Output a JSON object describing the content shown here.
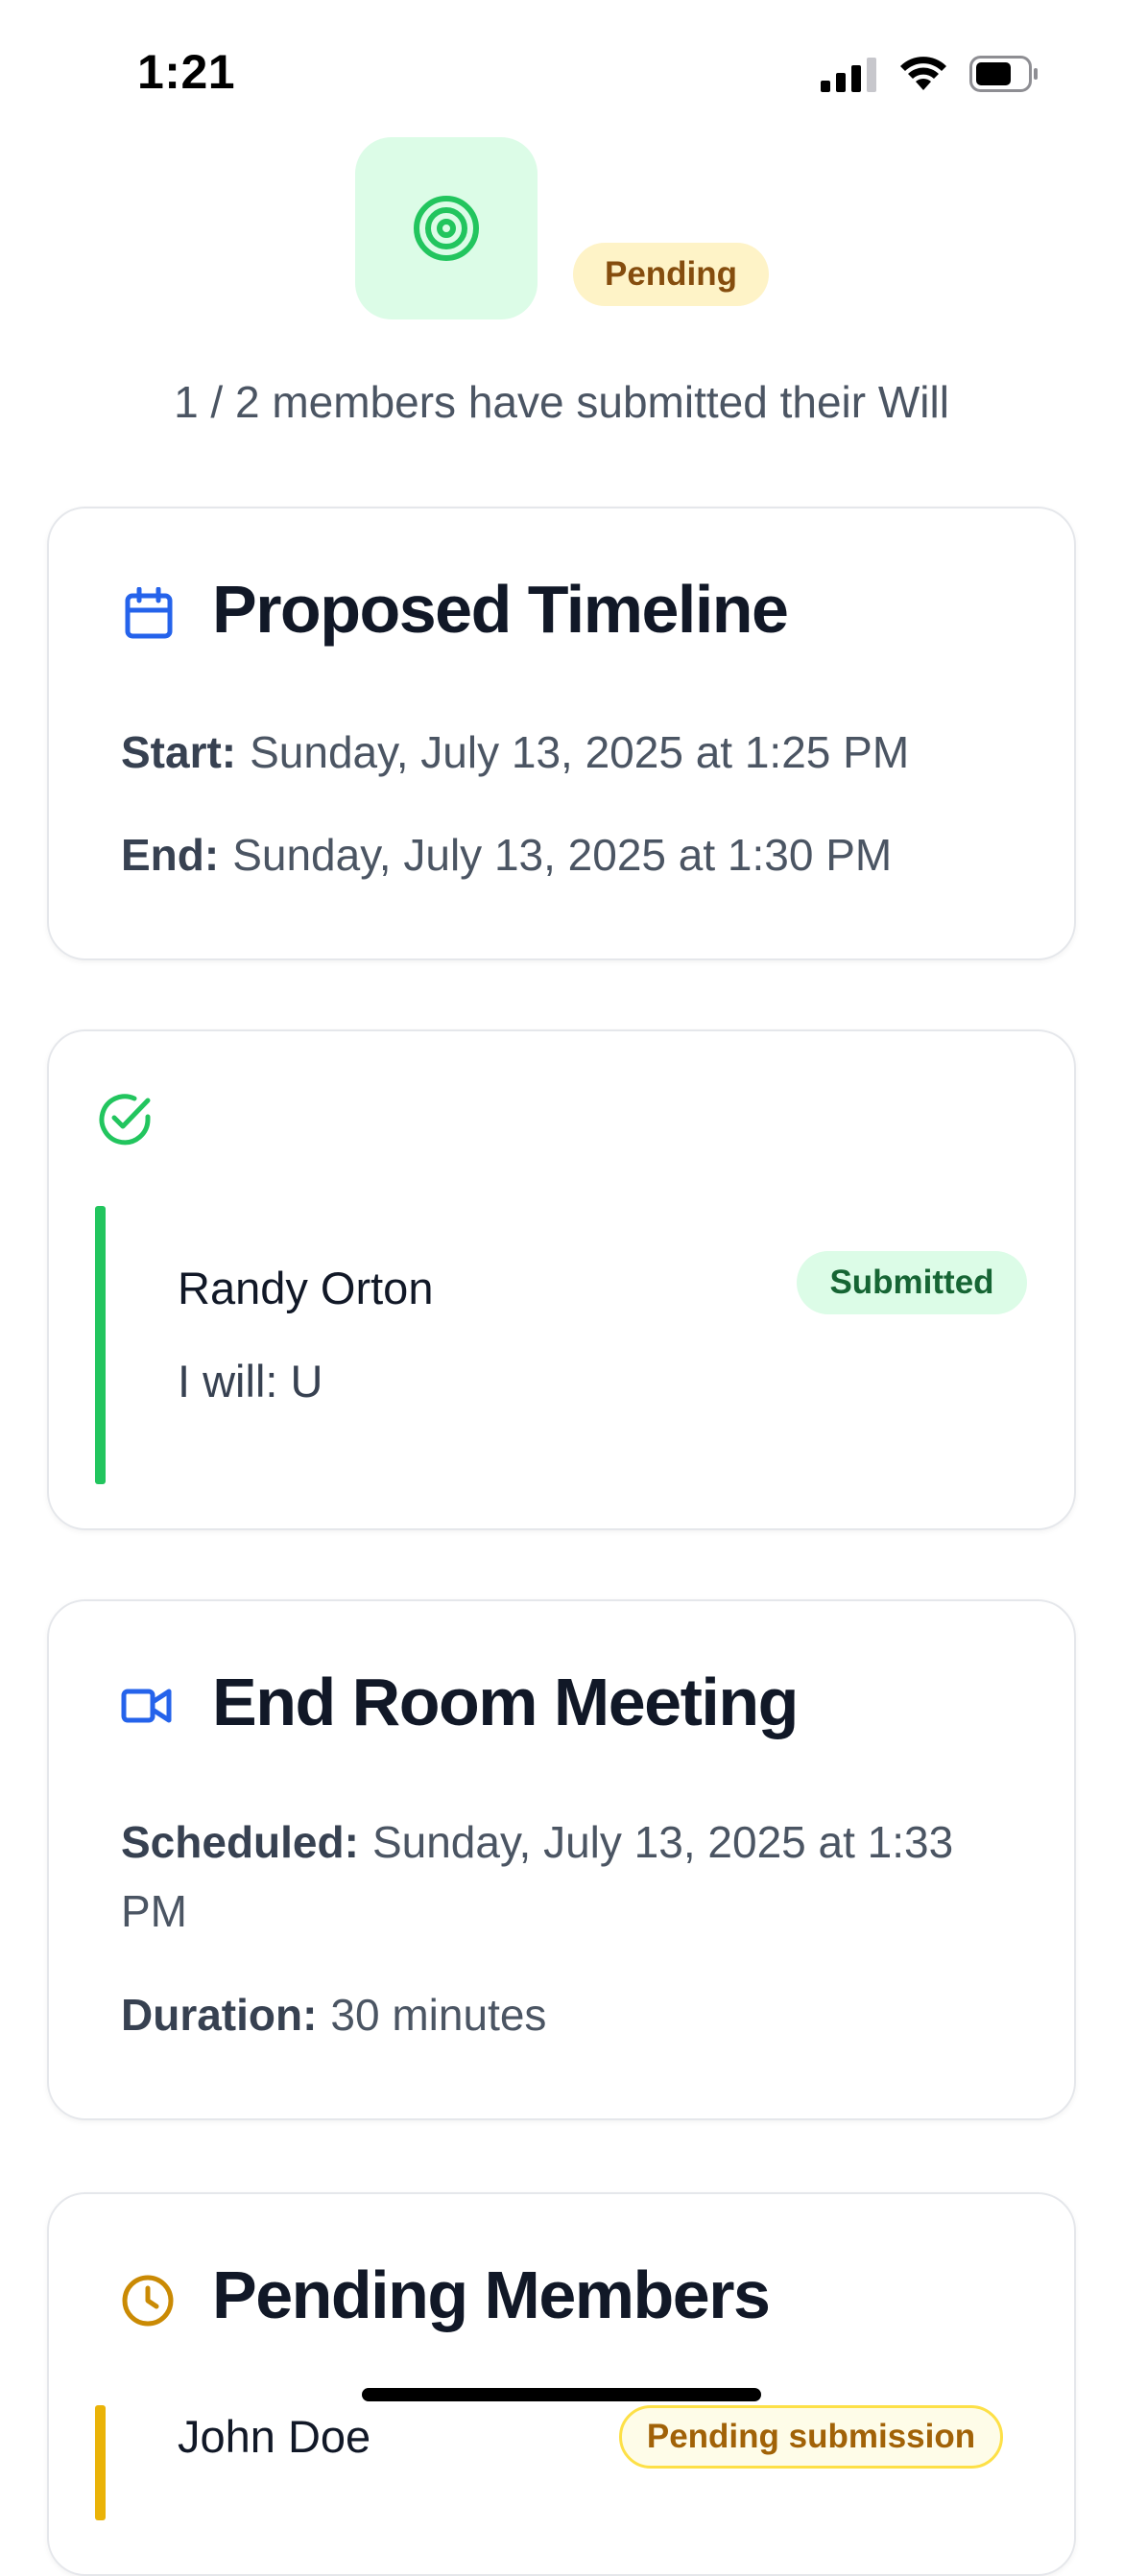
{
  "status_bar": {
    "time": "1:21",
    "signal_icon": "cellular-signal-icon",
    "wifi_icon": "wifi-icon",
    "battery_icon": "battery-icon"
  },
  "header": {
    "icon": "target-icon",
    "status_badge": "Pending",
    "submission_summary": "1 / 2 members have submitted their Will"
  },
  "timeline": {
    "icon": "calendar-icon",
    "title": "Proposed Timeline",
    "start_label": "Start:",
    "start_value": "Sunday, July 13, 2025 at 1:25 PM",
    "end_label": "End:",
    "end_value": "Sunday, July 13, 2025 at 1:30 PM"
  },
  "submitted": {
    "icon": "check-circle-icon",
    "members": [
      {
        "name": "Randy Orton",
        "status": "Submitted",
        "will": "I will: U"
      }
    ],
    "colors": {
      "bar": "#22c55e",
      "badge_bg": "#dcfce7",
      "badge_text": "#166534"
    }
  },
  "meeting": {
    "icon": "video-icon",
    "title": "End Room Meeting",
    "scheduled_label": "Scheduled:",
    "scheduled_value": "Sunday, July 13, 2025 at 1:33 PM",
    "duration_label": "Duration:",
    "duration_value": "30 minutes"
  },
  "pending_members": {
    "icon": "clock-icon",
    "title": "Pending Members",
    "members": [
      {
        "name": "John Doe",
        "status": "Pending submission"
      }
    ],
    "colors": {
      "bar": "#eab308",
      "badge_border": "#fde047",
      "badge_text": "#a16207"
    }
  },
  "colors": {
    "accent_blue": "#2563eb",
    "accent_green": "#22c55e",
    "pending_yellow": "#fef3c7",
    "pending_text": "#854d0e"
  }
}
